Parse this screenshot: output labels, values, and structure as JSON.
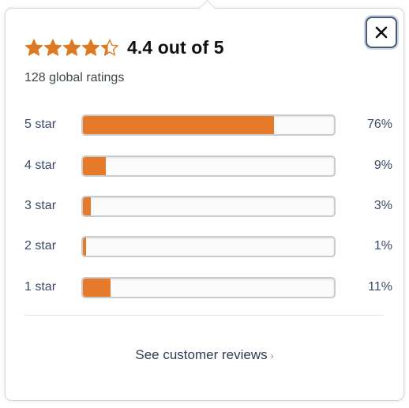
{
  "popover": {
    "average": 4.4,
    "average_text": "4.4 out of 5",
    "total_text": "128 global ratings",
    "close_label": "×",
    "star_color": "#de7921",
    "bar_color": "#e47a2a",
    "histogram": [
      {
        "label": "5 star",
        "pct_text": "76%",
        "fraction": 0.76
      },
      {
        "label": "4 star",
        "pct_text": "9%",
        "fraction": 0.09
      },
      {
        "label": "3 star",
        "pct_text": "3%",
        "fraction": 0.03
      },
      {
        "label": "2 star",
        "pct_text": "1%",
        "fraction": 0.01
      },
      {
        "label": "1 star",
        "pct_text": "11%",
        "fraction": 0.11
      }
    ],
    "see_reviews_label": "See customer reviews",
    "see_reviews_chevron": "›",
    "icons": {
      "close": "close-icon",
      "star_full": "star-full-icon",
      "star_partial": "star-partial-icon"
    }
  }
}
